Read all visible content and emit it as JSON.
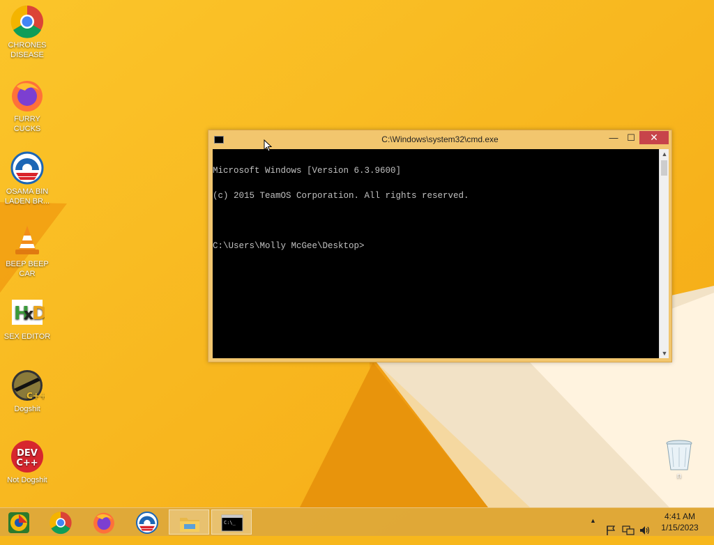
{
  "desktop": {
    "icons": [
      {
        "label": "CHRONES DISEASE",
        "icon": "chrome-icon"
      },
      {
        "label": "FURRY CUCKS",
        "icon": "firefox-icon"
      },
      {
        "label": "OSAMA BIN LADEN BR...",
        "icon": "obama-logo-icon"
      },
      {
        "label": "BEEP BEEP CAR",
        "icon": "vlc-cone-icon"
      },
      {
        "label": "SEX EDITOR",
        "icon": "hxd-icon"
      },
      {
        "label": "Dogshit",
        "icon": "codeblocks-icon"
      },
      {
        "label": "Not Dogshit",
        "icon": "devcpp-icon"
      }
    ],
    "recycle_bin": {
      "label": "n",
      "icon": "recycle-bin-icon"
    }
  },
  "cmd": {
    "title": "C:\\Windows\\system32\\cmd.exe",
    "lines": [
      "Microsoft Windows [Version 6.3.9600]",
      "(c) 2015 TeamOS Corporation. All rights reserved.",
      "",
      "C:\\Users\\Molly McGee\\Desktop>"
    ],
    "minimize": "—",
    "maximize": "☐",
    "close": "✕"
  },
  "taskbar": {
    "items": [
      "chrome-canary-icon",
      "chrome-icon",
      "firefox-icon",
      "obama-logo-icon",
      "file-explorer-icon",
      "cmd-icon"
    ],
    "time": "4:41 AM",
    "date": "1/15/2023"
  },
  "colors": {
    "wallpaper_base": "#f7b71c",
    "taskbar": "#dea83a",
    "close_button": "#c7444a"
  }
}
